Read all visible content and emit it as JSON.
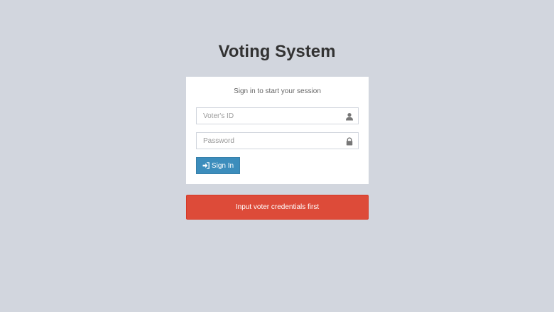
{
  "header": {
    "title": "Voting System"
  },
  "login": {
    "message": "Sign in to start your session",
    "voter_id": {
      "placeholder": "Voter's ID",
      "value": "",
      "icon": "user-icon"
    },
    "password": {
      "placeholder": "Password",
      "value": "",
      "icon": "lock-icon"
    },
    "submit": {
      "label": "Sign In",
      "icon": "sign-in-icon"
    }
  },
  "alert": {
    "text": "Input voter credentials first"
  },
  "colors": {
    "background": "#d2d6de",
    "primary": "#3c8dbc",
    "danger": "#dd4b39"
  }
}
